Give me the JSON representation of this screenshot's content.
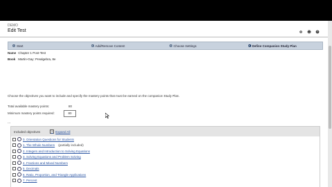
{
  "header": {
    "topline": "DEMO",
    "title": "Edit Test",
    "icons": [
      "gear-icon",
      "print-icon",
      "help-icon"
    ]
  },
  "steps": [
    {
      "num": "1",
      "label": "Start"
    },
    {
      "num": "2",
      "label": "Add/Remove Content"
    },
    {
      "num": "3",
      "label": "Choose Settings"
    },
    {
      "num": "4",
      "label": "Define Companion Study Plan"
    }
  ],
  "meta": {
    "name_label": "Name",
    "name_value": "Chapter 1 Post-Test",
    "book_label": "Book",
    "book_value": "Martin-Gay: Prealgebra, 8e"
  },
  "instructions": "Choose the objectives you want to include and specify the mastery points that must be earned on the companion Study Plan.",
  "mastery": {
    "total_label": "Total available mastery points:",
    "total_value": "80",
    "min_label": "Minimum mastery points required:",
    "min_value": "80"
  },
  "ellipsis": "...",
  "objectives": {
    "header_label": "Included objectives",
    "expand_label": "Expand All",
    "items": [
      {
        "text": "0. Orientation Questions for Students",
        "extra": ""
      },
      {
        "text": "1. The Whole Numbers",
        "extra": "(partially included)"
      },
      {
        "text": "2. Integers and Introduction to Solving Equations",
        "extra": ""
      },
      {
        "text": "3. Solving Equations and Problem Solving",
        "extra": ""
      },
      {
        "text": "4. Fractions and Mixed Numbers",
        "extra": ""
      },
      {
        "text": "5. Decimals",
        "extra": ""
      },
      {
        "text": "6. Ratio, Proportion, and Triangle Applications",
        "extra": ""
      },
      {
        "text": "7. Percent",
        "extra": ""
      }
    ]
  }
}
